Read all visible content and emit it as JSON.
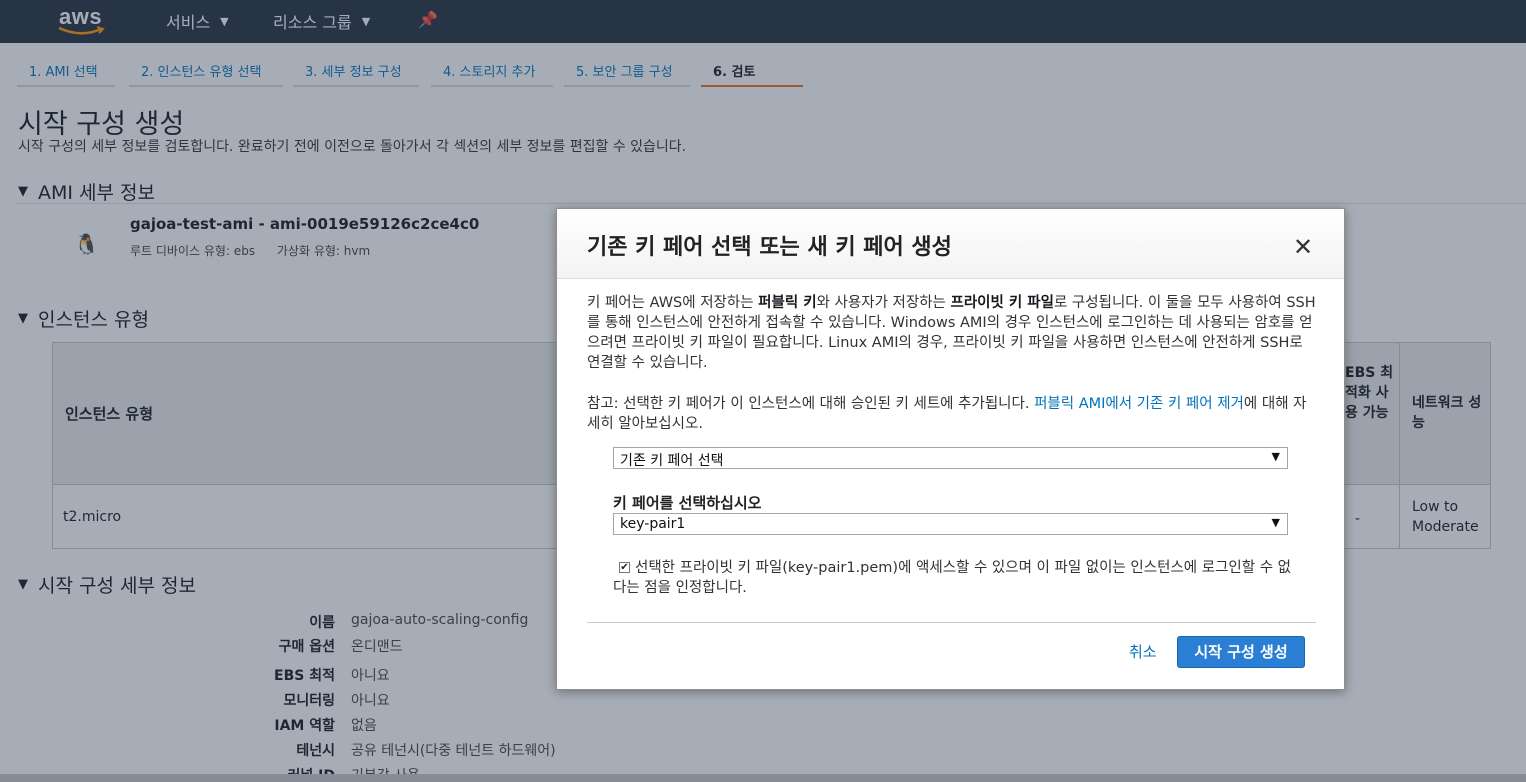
{
  "nav": {
    "logo": "aws",
    "services": "서비스",
    "resource_groups": "리소스 그룹",
    "pin_icon": "pushpin-icon"
  },
  "tabs": [
    {
      "label": "1. AMI 선택"
    },
    {
      "label": "2. 인스턴스 유형 선택"
    },
    {
      "label": "3. 세부 정보 구성"
    },
    {
      "label": "4. 스토리지 추가"
    },
    {
      "label": "5. 보안 그룹 구성"
    },
    {
      "label": "6. 검토"
    }
  ],
  "page": {
    "title": "시작 구성 생성",
    "description": "시작 구성의 세부 정보를 검토합니다. 완료하기 전에 이전으로 돌아가서 각 섹션의 세부 정보를 편집할 수 있습니다."
  },
  "ami_section": {
    "title": "AMI 세부 정보",
    "name": "gajoa-test-ami - ami-0019e59126c2ce4c0",
    "root_device": "루트 디바이스 유형: ebs",
    "virtualization": "가상화 유형: hvm"
  },
  "instance_section": {
    "title": "인스턴스 유형",
    "header_type": "인스턴스 유형",
    "header_ebs": "EBS 최적화 사용 가능",
    "header_net": "네트워크 성능",
    "row_type": "t2.micro",
    "row_ebs": "-",
    "row_net": "Low to Moderate"
  },
  "config_section": {
    "title": "시작 구성 세부 정보",
    "rows": [
      {
        "key": "이름",
        "value": "gajoa-auto-scaling-config"
      },
      {
        "key": "구매 옵션",
        "value": "온디맨드"
      },
      {
        "key": "EBS 최적",
        "value": "아니요"
      },
      {
        "key": "모니터링",
        "value": "아니요"
      },
      {
        "key": "IAM 역할",
        "value": "없음"
      },
      {
        "key": "테넌시",
        "value": "공유 테넌시(다중 테넌트 하드웨어)"
      },
      {
        "key": "커널 ID",
        "value": "기본값 사용"
      }
    ]
  },
  "modal": {
    "title": "기존 키 페어 선택 또는 새 키 페어 생성",
    "p1_a": "키 페어는 AWS에 저장하는 ",
    "p1_b": "퍼블릭 키",
    "p1_c": "와 사용자가 저장하는 ",
    "p1_d": "프라이빗 키 파일",
    "p1_e": "로 구성됩니다. 이 둘을 모두 사용하여 SSH를 통해 인스턴스에 안전하게 접속할 수 있습니다. Windows AMI의 경우 인스턴스에 로그인하는 데 사용되는 암호를 얻으려면 프라이빗 키 파일이 필요합니다. Linux AMI의 경우, 프라이빗 키 파일을 사용하면 인스턴스에 안전하게 SSH로 연결할 수 있습니다.",
    "note_a": "참고: 선택한 키 페어가 이 인스턴스에 대해 승인된 키 세트에 추가됩니다. ",
    "note_link": "퍼블릭 AMI에서 기존 키 페어 제거",
    "note_b": "에 대해 자세히 알아보십시오.",
    "select_mode": "기존 키 페어 선택",
    "keypair_label": "키 페어를 선택하십시오",
    "keypair_value": "key-pair1",
    "ack_text": "선택한 프라이빗 키 파일(key-pair1.pem)에 액세스할 수 있으며 이 파일 없이는 인스턴스에 로그인할 수 없다는 점을 인정합니다.",
    "ack_checked": true,
    "cancel": "취소",
    "submit": "시작 구성 생성"
  }
}
